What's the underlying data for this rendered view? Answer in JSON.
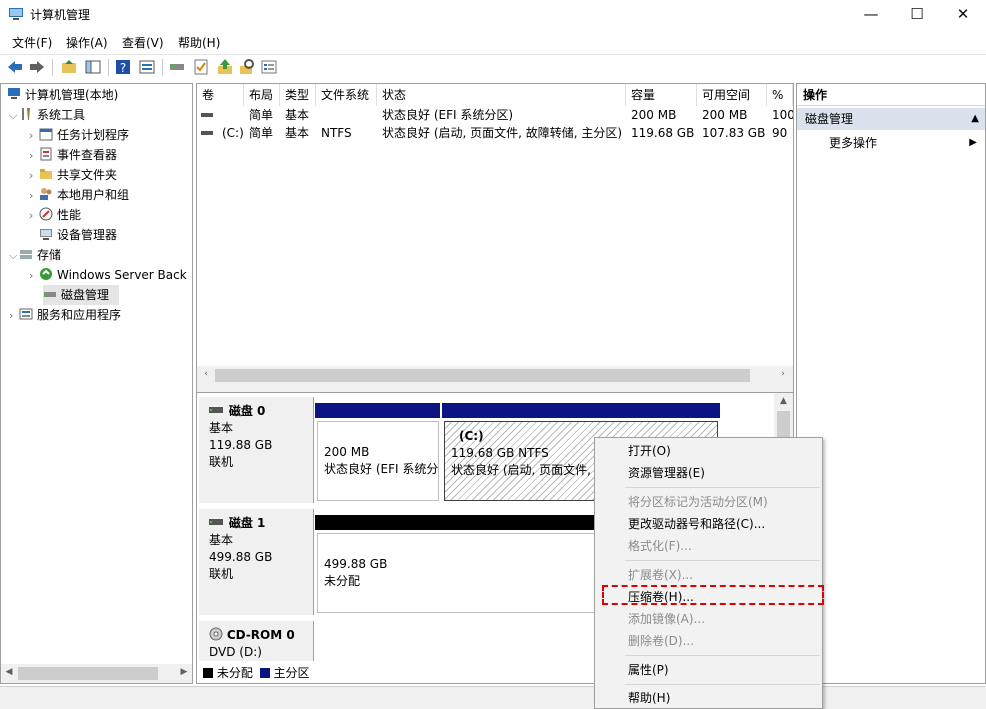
{
  "window": {
    "title": "计算机管理",
    "min_glyph": "—",
    "max_glyph": "☐",
    "close_glyph": "✕"
  },
  "menu": [
    "文件(F)",
    "操作(A)",
    "查看(V)",
    "帮助(H)"
  ],
  "tree": {
    "root": "计算机管理(本地)",
    "system_tools": "系统工具",
    "task_scheduler": "任务计划程序",
    "event_viewer": "事件查看器",
    "shared_folders": "共享文件夹",
    "local_users": "本地用户和组",
    "performance": "性能",
    "device_manager": "设备管理器",
    "storage": "存储",
    "wsb": "Windows Server Back",
    "disk_mgmt": "磁盘管理",
    "services": "服务和应用程序"
  },
  "table": {
    "headers": [
      "卷",
      "布局",
      "类型",
      "文件系统",
      "状态",
      "容量",
      "可用空间",
      "% 可"
    ],
    "rows": [
      {
        "vol": "",
        "layout": "简单",
        "type": "基本",
        "fs": "",
        "status": "状态良好 (EFI 系统分区)",
        "capacity": "200 MB",
        "free": "200 MB",
        "pct": "100"
      },
      {
        "vol": "(C:)",
        "layout": "简单",
        "type": "基本",
        "fs": "NTFS",
        "status": "状态良好 (启动, 页面文件, 故障转储, 主分区)",
        "capacity": "119.68 GB",
        "free": "107.83 GB",
        "pct": "90"
      }
    ]
  },
  "disks": {
    "disk0": {
      "name": "磁盘 0",
      "kind": "基本",
      "size": "119.88 GB",
      "state": "联机",
      "p1_size": "200 MB",
      "p1_status": "状态良好 (EFI 系统分",
      "p2_name": "(C:)",
      "p2_size": "119.68 GB NTFS",
      "p2_status": "状态良好 (启动, 页面文件, 故"
    },
    "disk1": {
      "name": "磁盘 1",
      "kind": "基本",
      "size": "499.88 GB",
      "state": "联机",
      "p1_size": "499.88 GB",
      "p1_status": "未分配"
    },
    "cdrom": {
      "name": "CD-ROM 0",
      "drive": "DVD (D:)"
    }
  },
  "legend": {
    "unallocated": "未分配",
    "primary": "主分区",
    "unallocated_color": "#000000",
    "primary_color": "#0a1482"
  },
  "actions": {
    "header": "操作",
    "section": "磁盘管理",
    "more": "更多操作"
  },
  "context_menu": {
    "open": "打开(O)",
    "explorer": "资源管理器(E)",
    "mark_active": "将分区标记为活动分区(M)",
    "change_letter": "更改驱动器号和路径(C)...",
    "format": "格式化(F)...",
    "extend": "扩展卷(X)...",
    "shrink": "压缩卷(H)...",
    "mirror": "添加镜像(A)...",
    "delete": "删除卷(D)...",
    "properties": "属性(P)",
    "help": "帮助(H)"
  },
  "colors": {
    "highlight": "#e00000",
    "partition_bar": "#0a1482",
    "selected_tree": "#e5e5e5"
  }
}
